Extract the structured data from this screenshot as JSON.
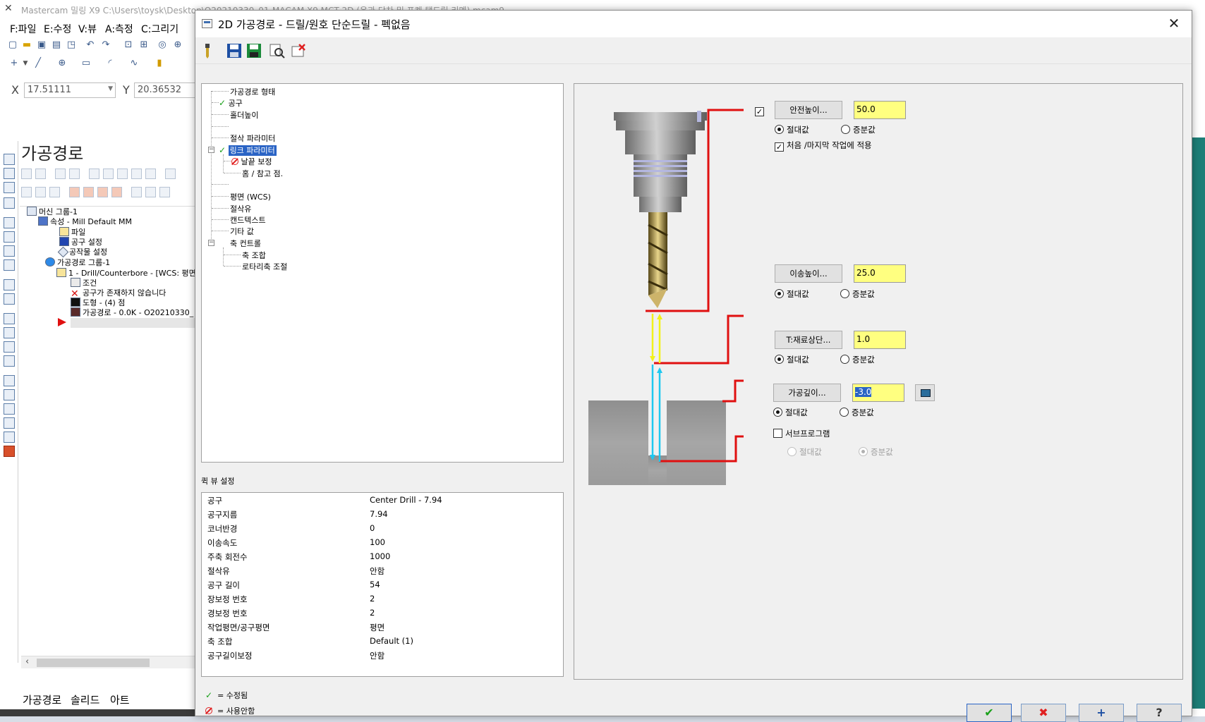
{
  "main_window": {
    "title": "Mastercam 밀링 X9  C:\\Users\\toysk\\Desktop\\O20210330_01-MACAM X9 MCT 2D (온과 단차 및 표켓 탭드릴 리멘).mcam9",
    "menu": [
      "F:파일",
      "E:수정",
      "V:뷰",
      "A:측정",
      "C:그리기"
    ],
    "coords": {
      "x_label": "X",
      "x_value": "17.51111",
      "y_label": "Y",
      "y_value": "20.36532"
    },
    "panel_title": "가공경로",
    "tree": [
      {
        "label": "머신 그룹-1"
      },
      {
        "label": "속성 - Mill Default MM"
      },
      {
        "label": "파일"
      },
      {
        "label": "공구 설정"
      },
      {
        "label": "공작물 설정"
      },
      {
        "label": "가공경로 그룹-1"
      },
      {
        "label": "1 - Drill/Counterbore - [WCS: 평면"
      },
      {
        "label": "조건"
      },
      {
        "label": "공구가 존재하지 않습니다"
      },
      {
        "label": "도형 - (4) 점"
      },
      {
        "label": "가공경로 - 0.0K - O20210330_"
      }
    ],
    "bottom_tabs": [
      "가공경로",
      "솔리드",
      "아트"
    ]
  },
  "dialog": {
    "title": "2D 가공경로 - 드릴/원호 단순드릴 - 펙없음",
    "tree": {
      "items": [
        "가공경로 형태",
        "공구",
        "홀더높이",
        "절삭 파라미터",
        "링크 파라미터",
        "날끝 보정",
        "홈 / 참고 점.",
        "평면 (WCS)",
        "절삭유",
        "캔드텍스트",
        "기타 값",
        "축 컨트롤",
        "축 조합",
        "로타리축 조절"
      ]
    },
    "quick_view": {
      "title": "퀵 뷰 설정",
      "rows": [
        {
          "key": "공구",
          "value": "Center Drill - 7.94"
        },
        {
          "key": "공구지름",
          "value": "7.94"
        },
        {
          "key": "코너반경",
          "value": "0"
        },
        {
          "key": "이송속도",
          "value": "100"
        },
        {
          "key": "주축 회전수",
          "value": "1000"
        },
        {
          "key": "절삭유",
          "value": "안함"
        },
        {
          "key": "공구 길이",
          "value": "54"
        },
        {
          "key": "장보정 번호",
          "value": "2"
        },
        {
          "key": "경보정 번호",
          "value": "2"
        },
        {
          "key": "작업평면/공구평면",
          "value": "평면"
        },
        {
          "key": "축 조합",
          "value": "Default (1)"
        },
        {
          "key": "공구길이보정",
          "value": "안함"
        }
      ]
    },
    "legend": {
      "edited": "= 수정됨",
      "disabled": "= 사용안함"
    },
    "params": {
      "clearance": {
        "label": "안전높이...",
        "value": "50.0",
        "absolute": "절대값",
        "incremental": "증분값",
        "apply_first_last": "처음 /마지막 작업에 적용"
      },
      "retract": {
        "label": "이송높이...",
        "value": "25.0",
        "absolute": "절대값",
        "incremental": "증분값"
      },
      "top_stock": {
        "label": "T:재료상단...",
        "value": "1.0",
        "absolute": "절대값",
        "incremental": "증분값"
      },
      "depth": {
        "label": "가공깊이...",
        "value": "-3.0",
        "absolute": "절대값",
        "incremental": "증분값"
      },
      "subprogram": {
        "label": "서브프로그램",
        "absolute": "절대값",
        "incremental": "증분값"
      }
    },
    "buttons": {
      "ok": "✔",
      "cancel": "✖",
      "add": "+",
      "help": "?"
    }
  }
}
